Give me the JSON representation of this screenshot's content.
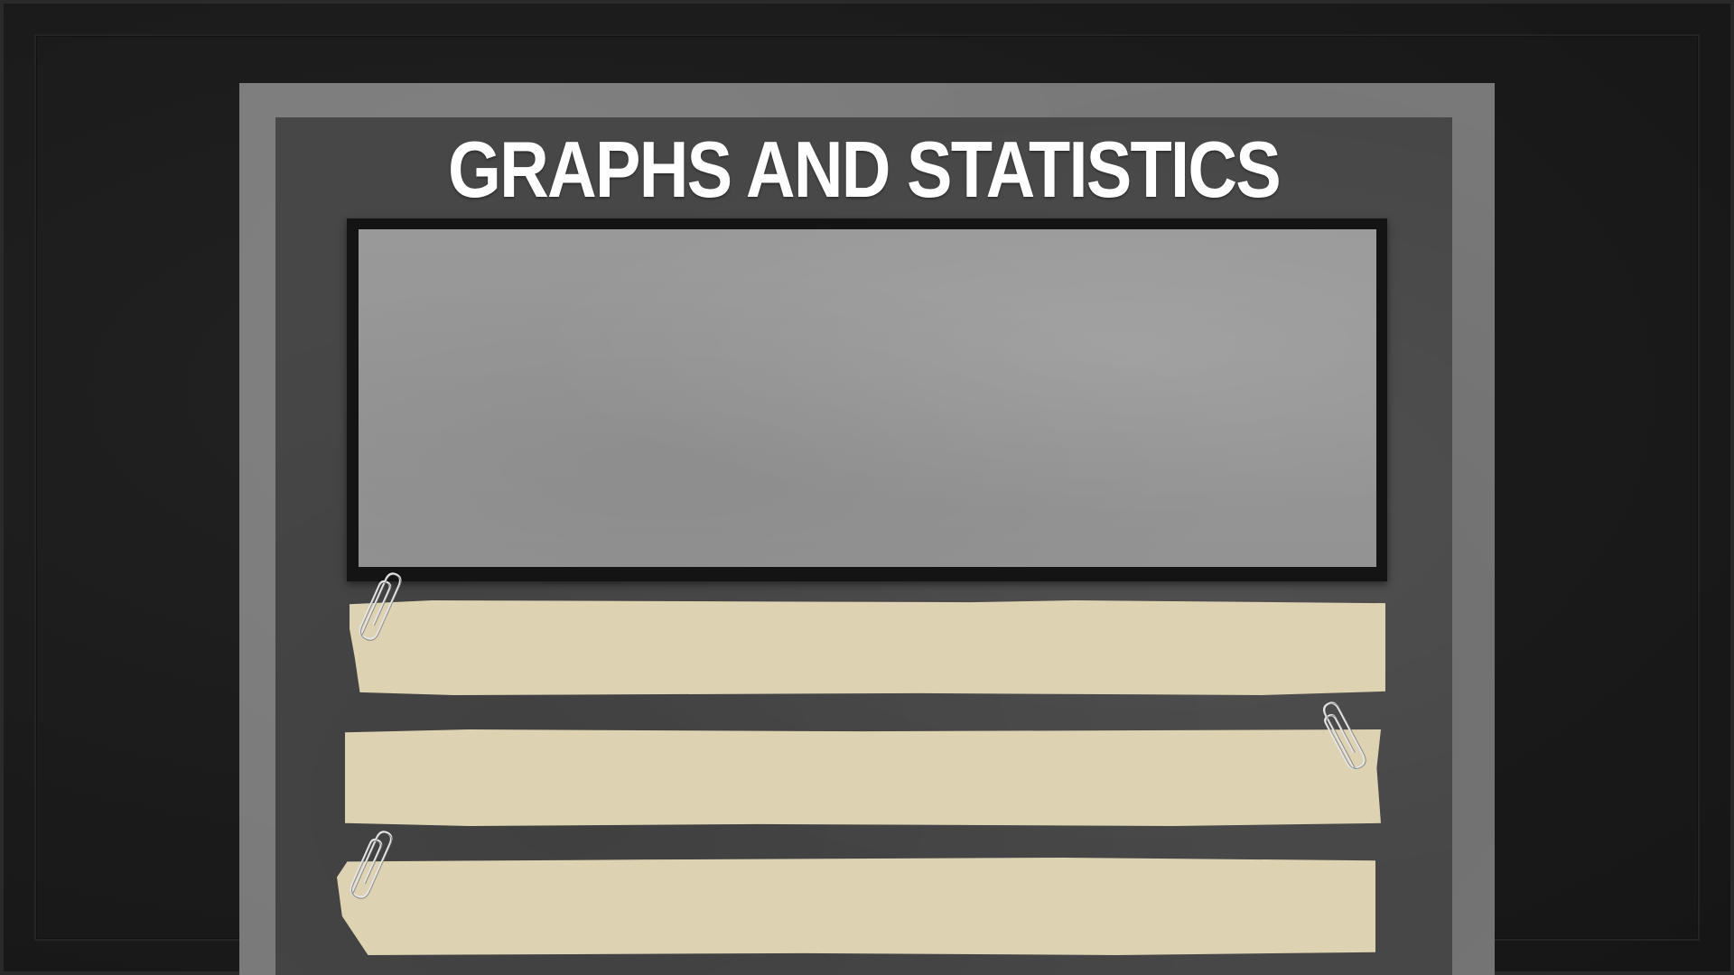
{
  "slide": {
    "title": "GRAPHS AND STATISTICS"
  },
  "colors": {
    "background": "#1b1b1b",
    "board_outer": "#7a7a7a",
    "board_inner": "#474747",
    "photo_frame": "#141414",
    "photo_area": "#979797",
    "paper_strip": "#ddd2b2",
    "title_text": "#ffffff"
  },
  "decorations": {
    "clip_icon": "paperclip-icon"
  }
}
